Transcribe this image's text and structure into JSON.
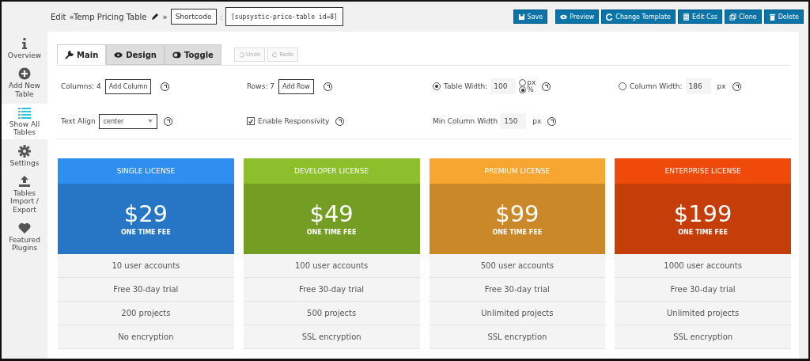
{
  "header": {
    "prefix": "Edit",
    "table_name": "«Temp Pricing Table",
    "suffix": "»",
    "shortcode_select": "Shortcode",
    "separator": ":",
    "shortcode": "[supsystic-price-table id=8]"
  },
  "actions": [
    {
      "label": "Save",
      "kind": "save"
    },
    {
      "label": "Preview",
      "kind": "eye"
    },
    {
      "label": "Change Template",
      "kind": "refresh"
    },
    {
      "label": "Edit Css",
      "kind": "file"
    },
    {
      "label": "Clone",
      "kind": "clone"
    },
    {
      "label": "Delete",
      "kind": "trash"
    }
  ],
  "sidebar": {
    "items": [
      {
        "label": "Overview",
        "kind": "info",
        "selected": false
      },
      {
        "label": "Add New Table",
        "kind": "plus",
        "selected": false
      },
      {
        "label": "Show All Tables",
        "kind": "list",
        "selected": true
      },
      {
        "label": "Settings",
        "kind": "gear",
        "selected": false
      },
      {
        "label": "Tables Import / Export",
        "kind": "upload",
        "selected": false
      },
      {
        "label": "Featured Plugins",
        "kind": "heart",
        "selected": false
      }
    ]
  },
  "tabs": [
    {
      "label": "Main",
      "kind": "wrench",
      "selected": true
    },
    {
      "label": "Design",
      "kind": "eye",
      "selected": false
    },
    {
      "label": "Toggle",
      "kind": "toggle",
      "selected": false
    }
  ],
  "history": [
    {
      "label": "Undo",
      "kind": "undo",
      "disabled": true
    },
    {
      "label": "Redo",
      "kind": "redo",
      "disabled": true
    }
  ],
  "settings": {
    "columns_label": "Columns: 4",
    "add_column": "Add Column",
    "rows_label": "Rows: 7",
    "add_row": "Add Row",
    "table_width": {
      "selected": true,
      "label": "Table Width:",
      "value": "100",
      "units": [
        {
          "label": "px",
          "selected": false
        },
        {
          "label": "%",
          "selected": true
        }
      ]
    },
    "column_width": {
      "selected": false,
      "label": "Column Width:",
      "value": "186",
      "unit": "px"
    },
    "text_align": {
      "label": "Text Align",
      "value": "center"
    },
    "responsivity": {
      "label": "Enable Responsivity",
      "checked": true
    },
    "min_column_width": {
      "label": "Min Column Width",
      "value": "150",
      "unit": "px"
    }
  },
  "plans": [
    {
      "name": "SINGLE LICENSE",
      "price": "$29",
      "fee": "ONE TIME FEE",
      "color": "#2f8ff0",
      "features": [
        "10 user accounts",
        "Free 30-day trial",
        "200 projects",
        "No encryption"
      ]
    },
    {
      "name": "DEVELOPER LICENSE",
      "price": "$49",
      "fee": "ONE TIME FEE",
      "color": "#8dbf2c",
      "features": [
        "100 user accounts",
        "Free 30-day trial",
        "500 projects",
        "SSL encryption"
      ]
    },
    {
      "name": "PREMIUM LICENSE",
      "price": "$99",
      "fee": "ONE TIME FEE",
      "color": "#f8a632",
      "features": [
        "500 user accounts",
        "Free 30-day trial",
        "Unlimited projects",
        "SSL encryption"
      ]
    },
    {
      "name": "ENTERPRISE LICENSE",
      "price": "$199",
      "fee": "ONE TIME FEE",
      "color": "#f04a0a",
      "features": [
        "1000 user accounts",
        "Free 30-day trial",
        "Unlimited projects",
        "SSL encryption"
      ]
    }
  ]
}
